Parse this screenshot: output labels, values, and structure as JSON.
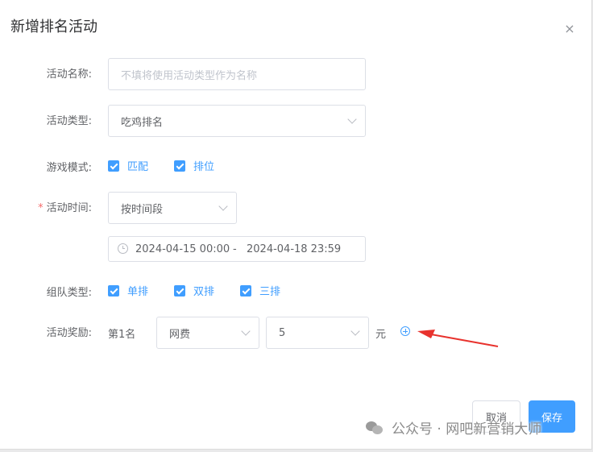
{
  "dialog": {
    "title": "新增排名活动",
    "close_glyph": "×"
  },
  "form": {
    "name": {
      "label": "活动名称:",
      "placeholder": "不填将使用活动类型作为名称",
      "value": ""
    },
    "type": {
      "label": "活动类型:",
      "value": "吃鸡排名"
    },
    "game_mode": {
      "label": "游戏模式:",
      "options": [
        {
          "label": "匹配",
          "checked": true
        },
        {
          "label": "排位",
          "checked": true
        }
      ]
    },
    "time": {
      "required_mark": "*",
      "label": "活动时间:",
      "mode_value": "按时间段",
      "start": "2024-04-15 00:00",
      "separator": "-",
      "end": "2024-04-18 23:59"
    },
    "team_type": {
      "label": "组队类型:",
      "options": [
        {
          "label": "单排",
          "checked": true
        },
        {
          "label": "双排",
          "checked": true
        },
        {
          "label": "三排",
          "checked": true
        }
      ]
    },
    "reward": {
      "label": "活动奖励:",
      "rank": "第1名",
      "reward_type": "网费",
      "amount": "5",
      "unit": "元"
    }
  },
  "footer": {
    "cancel_label": "取消",
    "save_label": "保存"
  },
  "watermark": {
    "text": "公众号 · 网吧新营销大师"
  },
  "colors": {
    "accent": "#409eff",
    "required": "#f56c6c",
    "arrow": "#e8322d"
  },
  "icons": [
    "close-icon",
    "chevron-down-icon",
    "checkbox-checked-icon",
    "clock-icon",
    "add-circle-icon",
    "wechat-icon",
    "annotation-arrow"
  ]
}
